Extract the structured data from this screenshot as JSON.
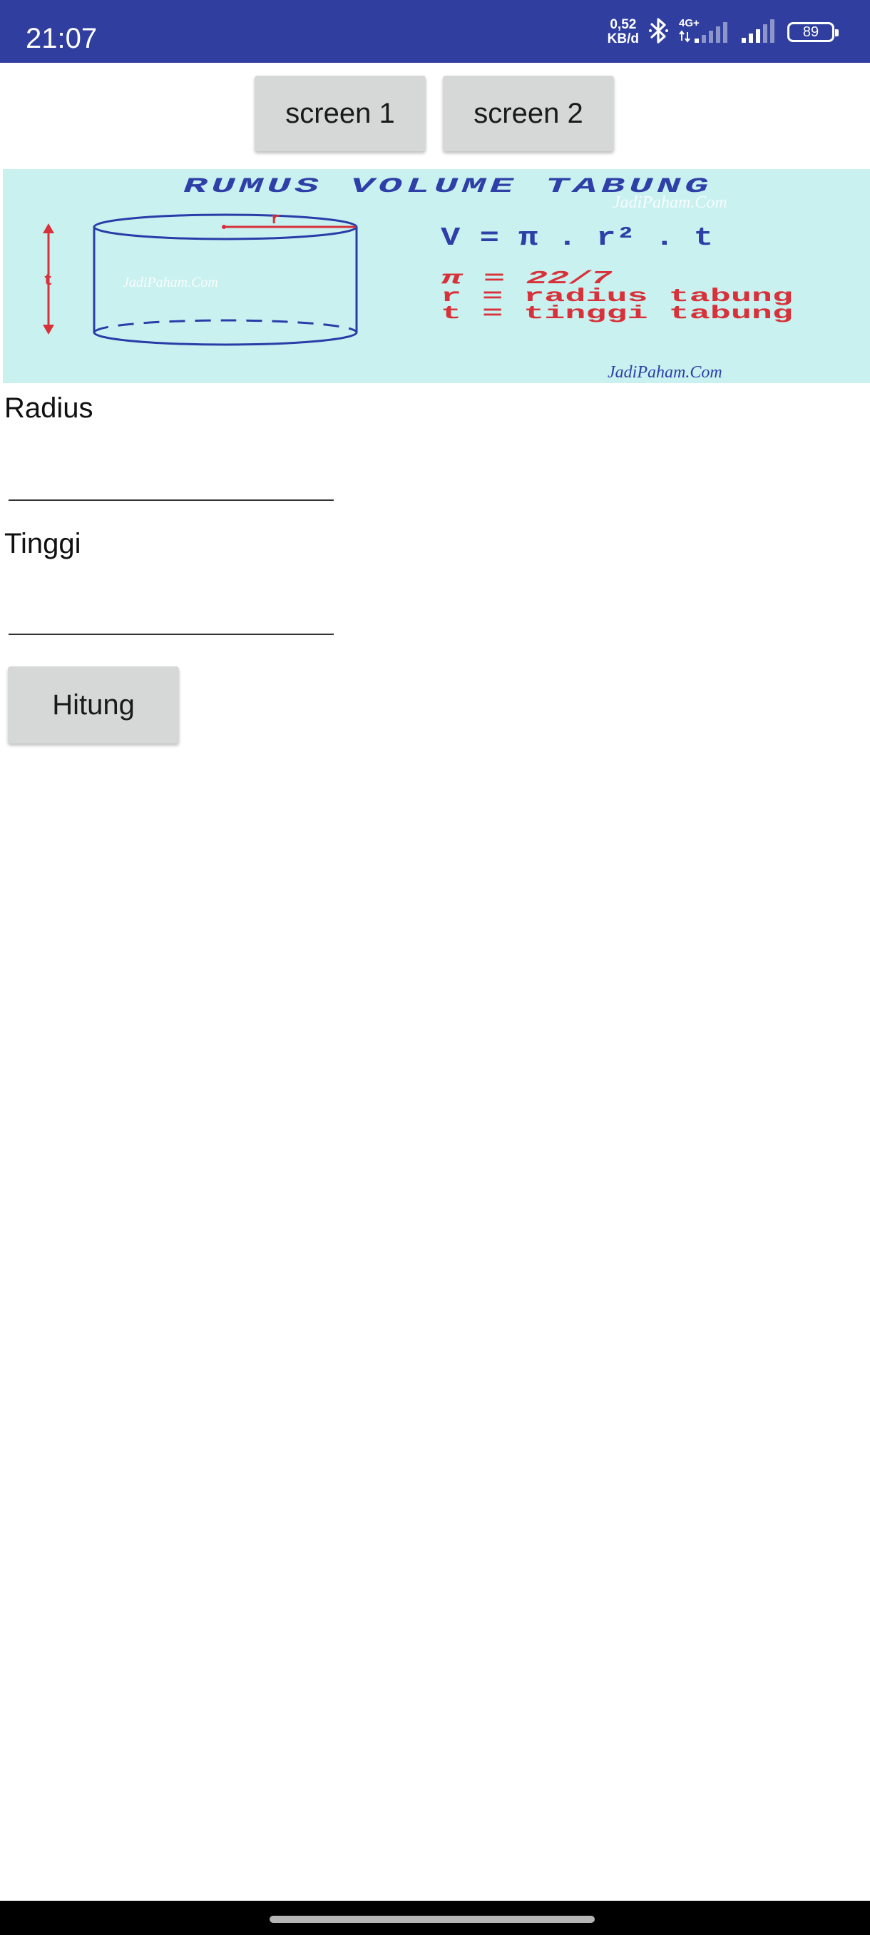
{
  "status_bar": {
    "time": "21:07",
    "net_speed_value": "0,52",
    "net_speed_unit": "KB/d",
    "network_type": "4G+",
    "battery_level": "89",
    "colors": {
      "background": "#303F9F",
      "foreground": "#FFFFFF"
    },
    "icons": [
      "bluetooth-icon",
      "mobile-signal-icon",
      "signal-icon",
      "battery-icon"
    ]
  },
  "toolbar": {
    "screen1_label": "screen 1",
    "screen2_label": "screen 2"
  },
  "formula_image": {
    "title": "RUMUS VOLUME TABUNG",
    "watermark": "JadiPaham.Com",
    "formula": "V = π . r² . t",
    "definitions": [
      "π = 22/7",
      "r = radius tabung",
      "t = tinggi tabung"
    ],
    "radius_symbol": "r",
    "height_symbol": "t",
    "colors": {
      "background": "#C9F1EF",
      "title": "#2E3FA8",
      "definitions": "#D8313A",
      "shape": "#2A3CA8"
    }
  },
  "form": {
    "radius_label": "Radius",
    "radius_value": "",
    "tinggi_label": "Tinggi",
    "tinggi_value": "",
    "hitung_label": "Hitung"
  }
}
